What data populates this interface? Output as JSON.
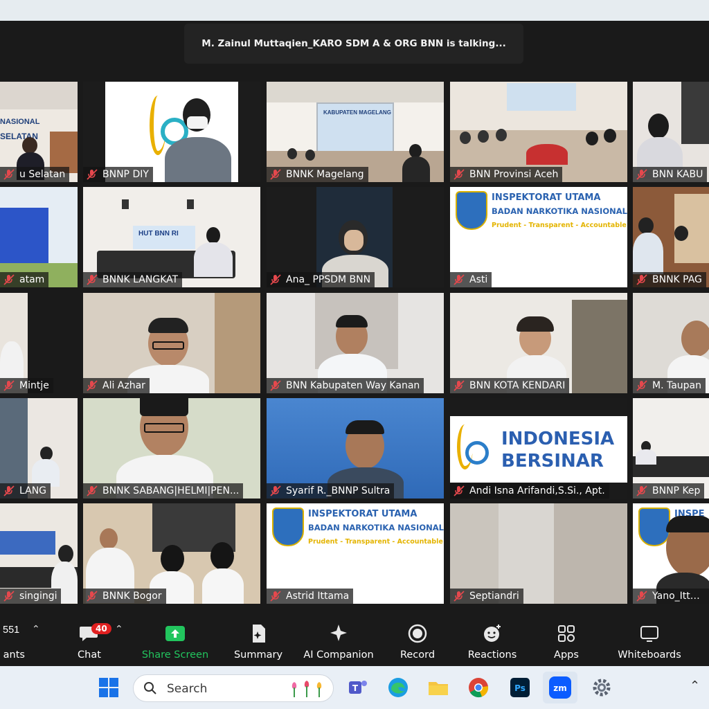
{
  "meeting": {
    "talking_banner": "M. Zainul Muttaqien_KARO SDM A & ORG BNN is talking..."
  },
  "tiles": [
    {
      "label": "u Selatan"
    },
    {
      "label": "BNNP DIY"
    },
    {
      "label": "BNNK Magelang"
    },
    {
      "label": "BNN Provinsi Aceh"
    },
    {
      "label": "BNN KABU"
    },
    {
      "label": "atam"
    },
    {
      "label": "BNNK LANGKAT"
    },
    {
      "label": "Ana_ PPSDM BNN"
    },
    {
      "label": "Asti"
    },
    {
      "label": "BNNK PAG"
    },
    {
      "label": "Mintje"
    },
    {
      "label": "Ali Azhar"
    },
    {
      "label": "BNN Kabupaten Way Kanan"
    },
    {
      "label": "BNN KOTA KENDARI"
    },
    {
      "label": "M. Taupan"
    },
    {
      "label": "LANG"
    },
    {
      "label": "BNNK SABANG|HELMI|PEN..."
    },
    {
      "label": "Syarif R._BNNP Sultra"
    },
    {
      "label": "Andi Isna Arifandi,S.Si., Apt."
    },
    {
      "label": "BNNP Kep"
    },
    {
      "label": "singingi"
    },
    {
      "label": "BNNK Bogor"
    },
    {
      "label": "Astrid Ittama"
    },
    {
      "label": "Septiandri"
    },
    {
      "label": "Yano_Ittam"
    }
  ],
  "tile_text": {
    "nasional_1": "NASIONAL",
    "nasional_2": "SELATAN",
    "kabupaten_magelang": "KABUPATEN MAGELANG",
    "insp_line1": "INSPEKTORAT UTAMA",
    "insp_line2": "BADAN NARKOTIKA NASIONAL",
    "insp_line3": "Prudent - Transparent - Accountable",
    "insp_line1_short": "INSPE",
    "indonesia": "INDONESIA",
    "bersinar": "BERSINAR",
    "hut_bnn": "HUT BNN RI"
  },
  "toolbar": {
    "participants_count": "551",
    "participants_label": "ants",
    "chat_label": "Chat",
    "chat_badge": "40",
    "share_label": "Share Screen",
    "summary_label": "Summary",
    "ai_label": "AI Companion",
    "record_label": "Record",
    "reactions_label": "Reactions",
    "apps_label": "Apps",
    "whiteboards_label": "Whiteboards"
  },
  "taskbar": {
    "search_placeholder": "Search"
  },
  "colors": {
    "share_green": "#22c55e",
    "badge_red": "#e02020",
    "mic_muted_red": "#e5484d",
    "insp_blue": "#2a62b0",
    "insp_yellow": "#e4b400"
  }
}
